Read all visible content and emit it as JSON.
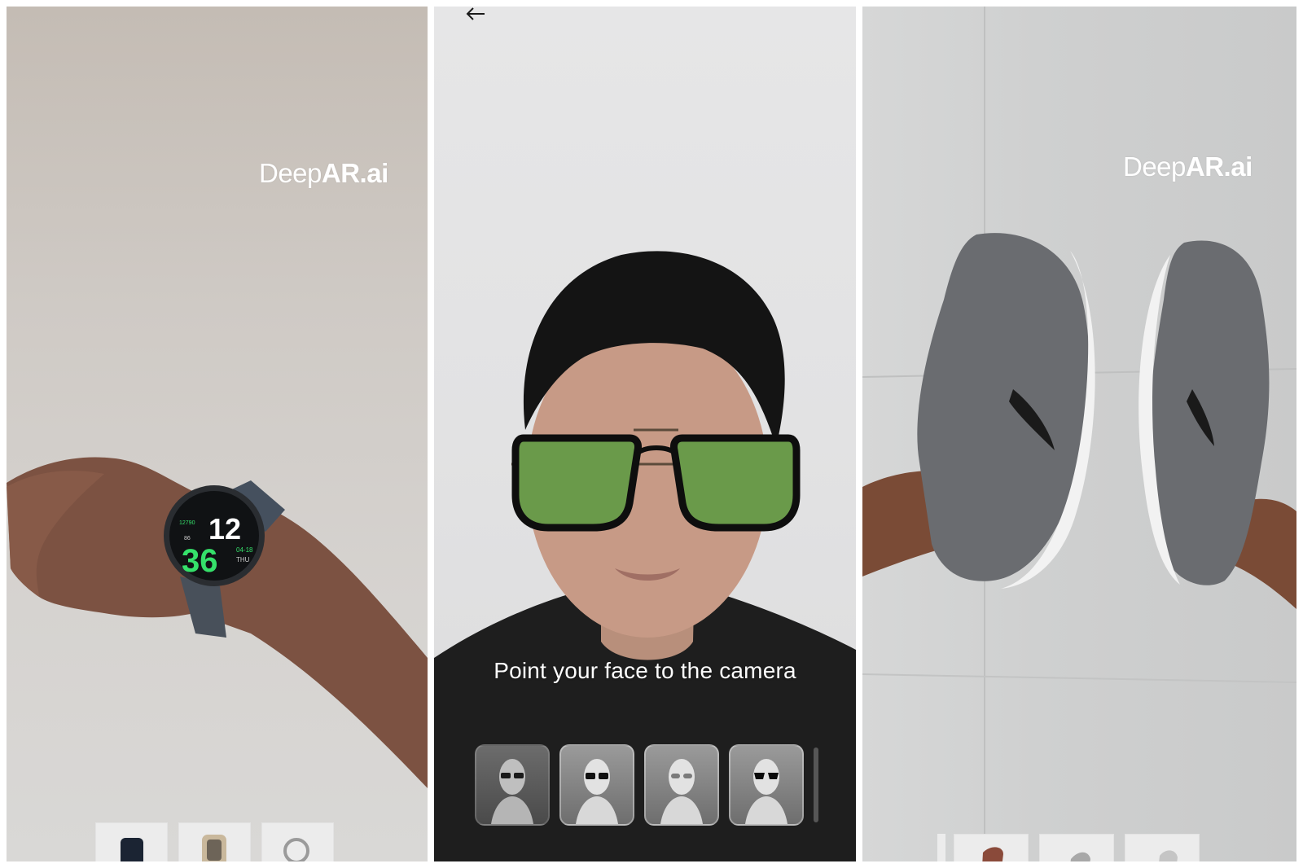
{
  "panels": [
    {
      "brand": {
        "prefix": "Deep",
        "bold": "AR.ai"
      },
      "watch": {
        "hour": "12",
        "minute": "36",
        "date": "04-18",
        "day": "THU",
        "steps": "12790",
        "pct": "86"
      }
    },
    {
      "hint": "Point your face to the camera",
      "back_icon": "back-arrow-icon",
      "accent": "#6a9a4a",
      "selected_index": 0,
      "items_count": 4
    },
    {
      "brand": {
        "prefix": "Deep",
        "bold": "AR.ai"
      }
    }
  ]
}
